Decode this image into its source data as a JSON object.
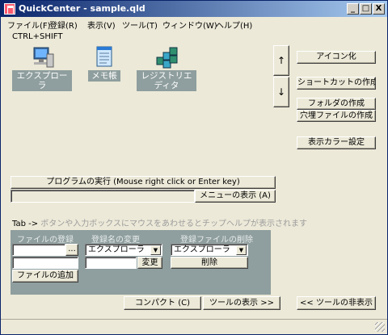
{
  "window": {
    "title": "QuickCenter - sample.qld"
  },
  "title_buttons": {
    "minimize": "_",
    "maximize": "□",
    "close": "X"
  },
  "menu": [
    "ファイル(F)",
    "登録(R)",
    "表示(V)",
    "ツール(T)",
    "ウィンドウ(W)",
    "ヘルプ(H)"
  ],
  "shortcut_hint": "CTRL+SHIFT",
  "apps": [
    {
      "label1": "エクスプローラ",
      "label2": "ラ",
      "icon": "explorer-icon"
    },
    {
      "label1": "メモ帳",
      "label2": "",
      "icon": "notepad-icon"
    },
    {
      "label1": "レジストリエ",
      "label2": "ディタ",
      "icon": "regedit-icon"
    }
  ],
  "nav": {
    "up": "↑",
    "down": "↓"
  },
  "right_buttons": {
    "iconize": "アイコン化",
    "shortcut": "ショートカットの作成",
    "folder": "フォルダの作成",
    "hole_file": "穴埋ファイルの作成",
    "display_color": "表示カラー設定"
  },
  "run": {
    "label": "プログラムの実行 (Mouse right click or Enter key)",
    "menu_button": "メニューの表示 (A)"
  },
  "hint": {
    "prefix": "Tab -> ",
    "text": "ボタンや入力ボックスにマウスをあわせるとチップヘルプが表示されます"
  },
  "panel": {
    "register_label": "ファイルの登録",
    "rename_label": "登録名の変更",
    "delete_label": "登録ファイルの削除",
    "browse": "...",
    "add_button": "ファイルの追加",
    "rename_select": "エクスプローラ",
    "change_button": "変更",
    "delete_select": "エクスプローラ",
    "delete_button": "削除"
  },
  "bottom": {
    "compact": "コンパクト (C)",
    "show_tools": "ツールの表示 >>",
    "hide_tools": "<< ツールの非表示"
  }
}
